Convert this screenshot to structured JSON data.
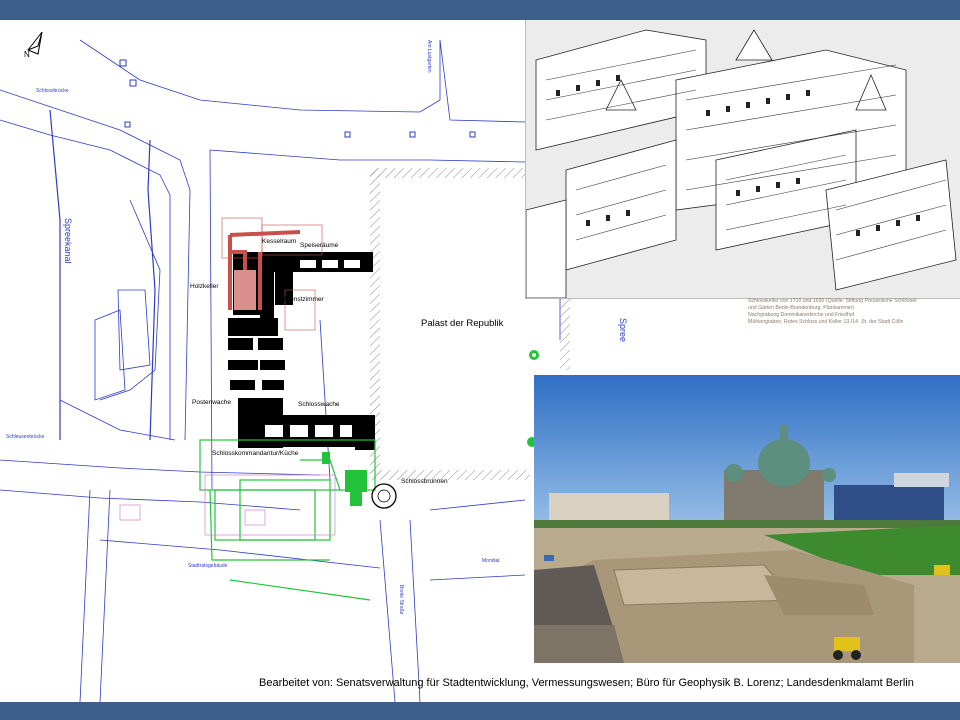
{
  "plan": {
    "palast": "Palast der Republik",
    "spreekanal": "Spreekanal",
    "spree": "Spree",
    "streets": {
      "schlossbruecke": "Schlossbrücke",
      "schleusenbruecke": "Schleusenbrücke",
      "stechbahn": "Stadtratsgebäude",
      "breite_strasse": "Breite Straße",
      "am_lustgarten": "Am Lustgarten",
      "mondial": "Mondial"
    },
    "rooms": {
      "kesselraum": "Kesselraum",
      "speiseraeume": "Speiseräume",
      "holzkeller": "Holzkeller",
      "dienstzimmer": "Dienstzimmer",
      "postenwache": "Postenwache",
      "schlosswache": "Schlosswache",
      "kommandantur": "Schlosskommandantur/Küche",
      "schlossbrunnen": "Schlossbrunnen"
    },
    "north_arrow": "N"
  },
  "engraving": {
    "caption": [
      "Schlosskeller von 1710 und 1690 (Quelle: Stiftung Preussische Schlösser",
      "und Gärten Berlin-Brandenburg, Plankammer)",
      "Nachgrabung Dominikanerkirche und Friedhof",
      "Mühlengraben, Rotes Schloss und Keller 13./14. Jh. der Stadt Cölln"
    ]
  },
  "credit": "Bearbeitet von: Senatsverwaltung für Stadtentwicklung, Vermessungswesen; Büro für Geophysik B. Lorenz; Landesdenkmalamt Berlin",
  "colors": {
    "frame": "#3b5e8d",
    "plan_lines": "#2d3cc6",
    "ruins_green": "#22c33a",
    "ruins_red": "#c7504c",
    "foundations": "#000000"
  }
}
